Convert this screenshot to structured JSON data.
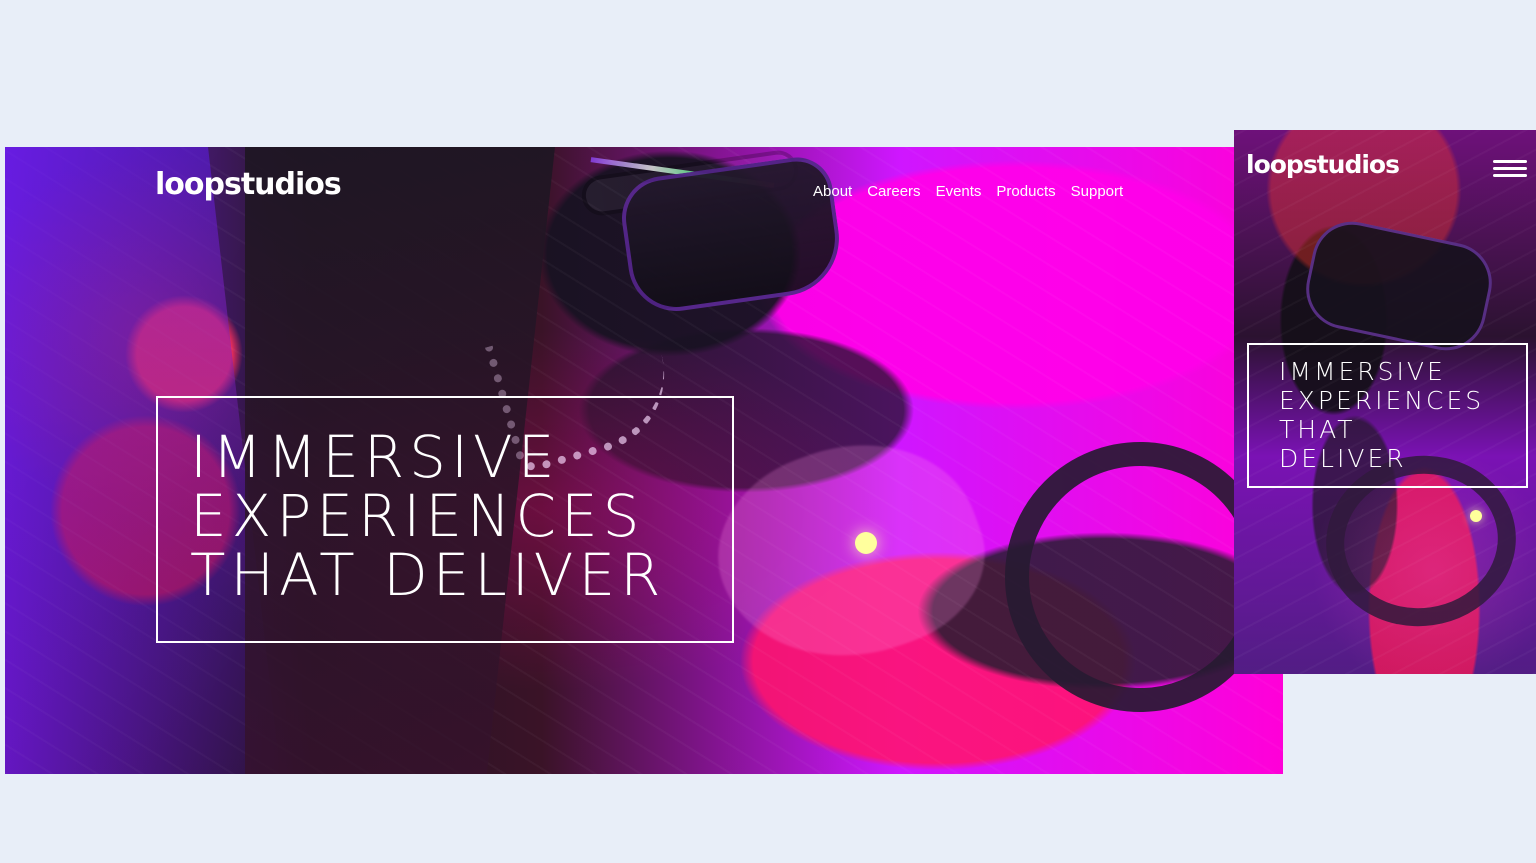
{
  "colors": {
    "page_background": "#e8eef8",
    "text": "#ffffff",
    "magenta": "#ff00d8",
    "violet": "#6e15d8",
    "pink": "#ff2b78"
  },
  "desktop": {
    "logo": "loopstudios",
    "nav": [
      {
        "label": "About"
      },
      {
        "label": "Careers"
      },
      {
        "label": "Events"
      },
      {
        "label": "Products"
      },
      {
        "label": "Support"
      }
    ],
    "hero": {
      "lines": [
        "IMMERSIVE",
        "EXPERIENCES",
        "THAT DELIVER"
      ]
    }
  },
  "mobile": {
    "logo": "loopstudios",
    "menu_icon": "hamburger-icon",
    "hero": {
      "lines": [
        "IMMERSIVE",
        "EXPERIENCES",
        "THAT",
        "DELIVER"
      ]
    }
  }
}
